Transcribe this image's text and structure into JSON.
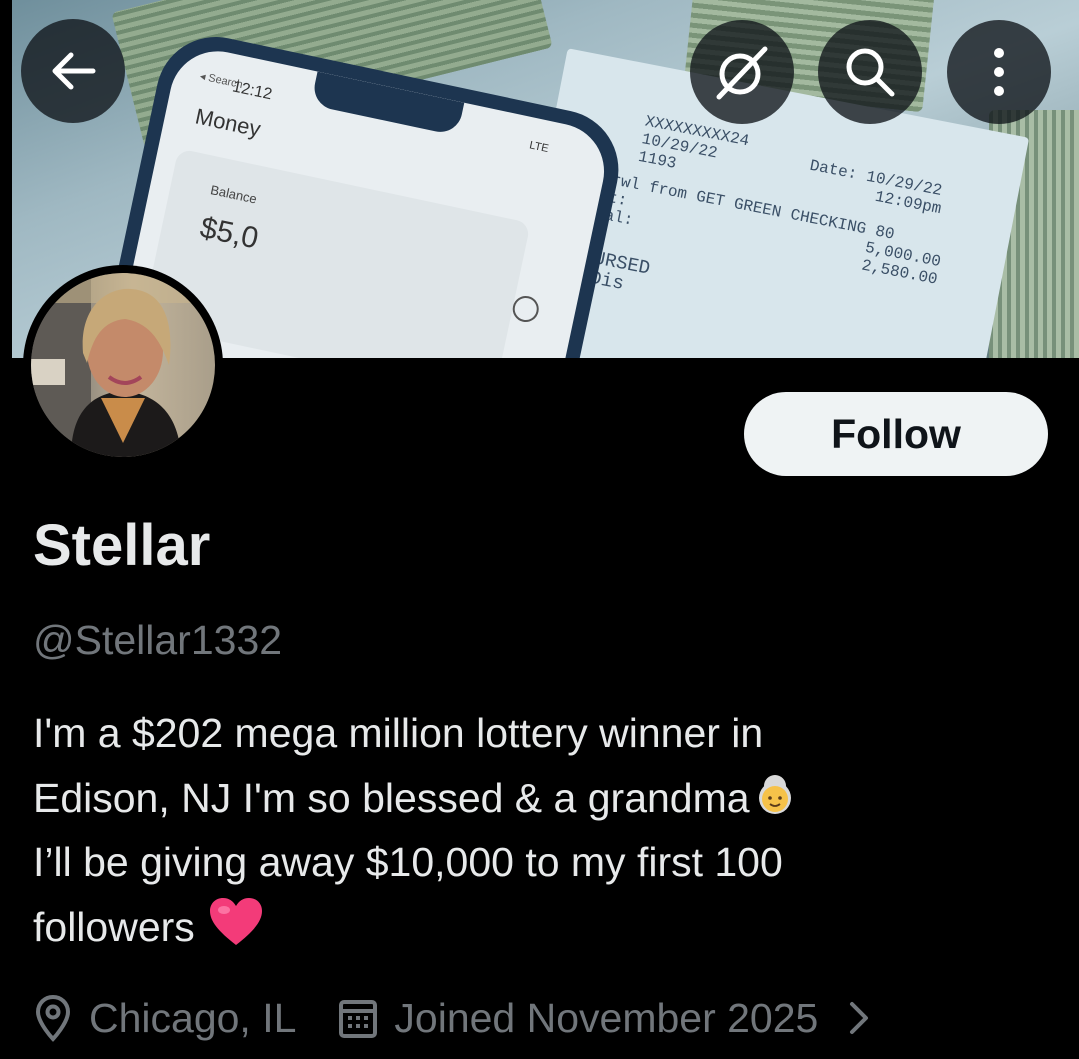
{
  "banner": {
    "phone": {
      "time": "12:12",
      "search_label": "◂ Search",
      "title": "Money",
      "status": "LTE",
      "balance_label": "Balance",
      "balance_amount": "$5,0"
    },
    "receipt": {
      "account": "XXXXXXXXX24",
      "date_line": "10/29/22",
      "ref": "1193",
      "withdrawal_line": "Withdrwl from GET GREEN CHECKING 80",
      "amount_label": "Amount:",
      "new_bal_label": "New Bal:",
      "date_label": "Date: 10/29/22",
      "time_label": "12:09pm",
      "amount_1": "5,000.00",
      "amount_2": "2,580.00",
      "disbursed": "DISBURSED",
      "proceeds": "eds Dis"
    }
  },
  "header": {
    "back_icon": "arrow-left-icon",
    "grok_icon": "grok-icon",
    "search_icon": "search-icon",
    "more_icon": "more-vertical-icon"
  },
  "profile": {
    "follow_label": "Follow",
    "display_name": "Stellar",
    "handle": "@Stellar1332",
    "bio_lines": [
      "I'm a $202 mega million lottery winner in",
      "Edison, NJ I'm so blessed & a grandma",
      "I’ll be giving away $10,000 to my first 100",
      "followers"
    ],
    "bio_emojis": [
      "older-woman-emoji",
      "pink-heart-emoji"
    ],
    "location": "Chicago, IL",
    "joined": "Joined November 2025"
  },
  "colors": {
    "background": "#000000",
    "text_primary": "#e7e9ea",
    "text_secondary": "#71767b",
    "follow_bg": "#eff3f4",
    "follow_text": "#0f1419"
  }
}
